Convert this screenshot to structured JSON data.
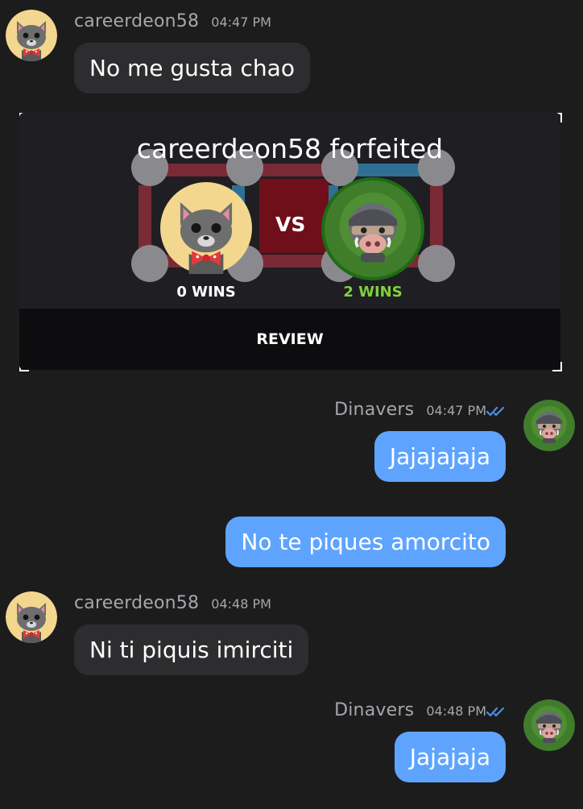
{
  "messages": [
    {
      "user": "careerdeon58",
      "time": "04:47 PM",
      "text": "No me gusta chao"
    },
    {
      "user": "Dinavers",
      "time": "04:47 PM",
      "texts": [
        "Jajajajaja",
        "No te piques amorcito"
      ]
    },
    {
      "user": "careerdeon58",
      "time": "04:48 PM",
      "text": "Ni ti piquis imirciti"
    },
    {
      "user": "Dinavers",
      "time": "04:48 PM",
      "text": "Jajajaja"
    }
  ],
  "game_card": {
    "title": "careerdeon58 forfeited",
    "vs_label": "VS",
    "left_wins": "0 WINS",
    "right_wins": "2 WINS",
    "review_label": "REVIEW"
  },
  "colors": {
    "background": "#1c1c1d",
    "incoming_bubble": "#2d2d2f",
    "outgoing_bubble": "#5ea4ff",
    "wins_green": "#7fd13b",
    "read_check": "#4a90e2"
  },
  "icons": {
    "cat_avatar": "cat-avatar-icon",
    "boar_avatar": "boar-avatar-icon",
    "read_receipt": "double-check-icon"
  }
}
